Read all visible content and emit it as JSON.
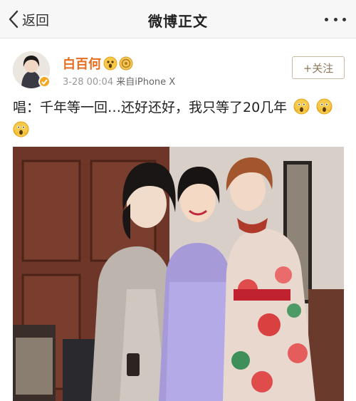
{
  "navbar": {
    "back_label": "返回",
    "title": "微博正文"
  },
  "post": {
    "username": "白百何",
    "date": "3-28 00:04",
    "source_prefix": "来自",
    "source_device": "iPhone X",
    "follow_label": "+关注",
    "text": "唱：千年等一回…还好还好，我只等了20几年"
  },
  "colors": {
    "username": "#e86d1f",
    "follow_border": "#c9b9a0",
    "verified_badge": "#f5a623"
  },
  "icons": {
    "back": "chevron-left-icon",
    "more": "more-dots-icon",
    "verified": "verified-badge-icon",
    "emoji": "scream-face-icon"
  }
}
